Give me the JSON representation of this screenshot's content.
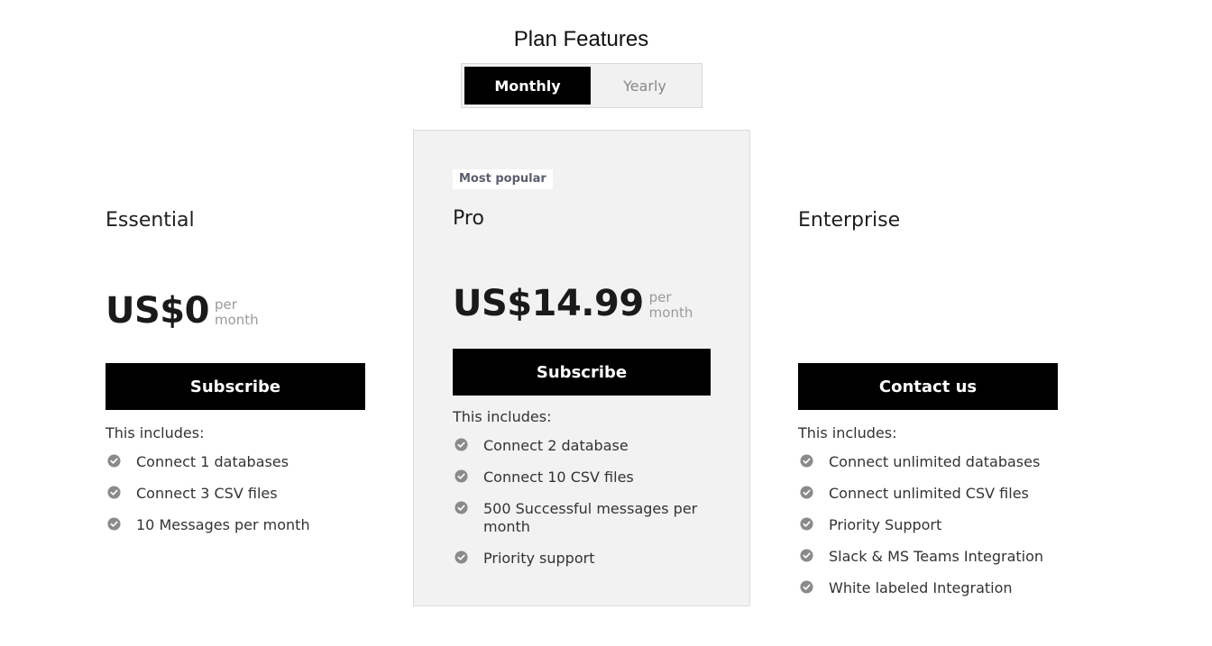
{
  "header": {
    "title": "Plan Features"
  },
  "billing_toggle": {
    "options": [
      {
        "label": "Monthly",
        "selected": true
      },
      {
        "label": "Yearly",
        "selected": false
      }
    ]
  },
  "colors": {
    "accent": "#000000",
    "featured_bg": "#f2f2f2",
    "check": "#8a8a8a",
    "badge_text": "#5a5f6e"
  },
  "plans": [
    {
      "name": "Essential",
      "price": "US$0",
      "period_line1": "per",
      "period_line2": "month",
      "cta": "Subscribe",
      "includes_label": "This includes:",
      "features": [
        "Connect 1 databases",
        "Connect 3 CSV files",
        "10 Messages per month"
      ]
    },
    {
      "badge": "Most popular",
      "name": "Pro",
      "price": "US$14.99",
      "period_line1": "per",
      "period_line2": "month",
      "cta": "Subscribe",
      "includes_label": "This includes:",
      "features": [
        "Connect 2 database",
        "Connect 10 CSV files",
        "500 Successful messages per month",
        "Priority support"
      ]
    },
    {
      "name": "Enterprise",
      "cta": "Contact us",
      "includes_label": "This includes:",
      "features": [
        "Connect unlimited databases",
        "Connect unlimited CSV files",
        "Priority Support",
        "Slack & MS Teams Integration",
        "White labeled Integration"
      ]
    }
  ]
}
